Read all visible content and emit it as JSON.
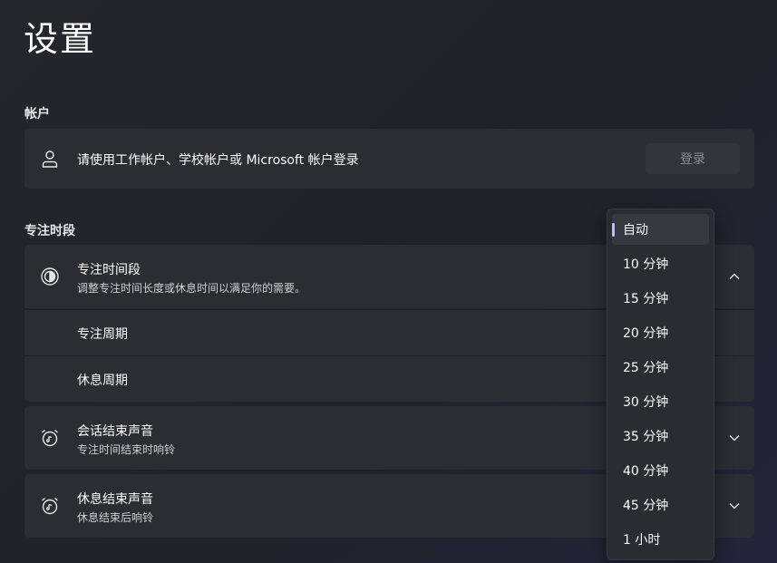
{
  "page": {
    "title": "设置"
  },
  "account": {
    "section_title": "帐户",
    "prompt": "请使用工作帐户、学校帐户或 Microsoft 帐户登录",
    "signin_label": "登录",
    "icon": "person-icon"
  },
  "focus": {
    "section_title": "专注时段",
    "session": {
      "title": "专注时间段",
      "subtitle": "调整专注时间长度或休息时间以满足你的需要。",
      "icon": "focus-timer-icon"
    },
    "focus_period_label": "专注周期",
    "break_period_label": "休息周期",
    "session_end_sound": {
      "title": "会话结束声音",
      "subtitle": "专注时间结束时响铃",
      "icon": "alarm-clock-icon"
    },
    "break_end_sound": {
      "title": "休息结束声音",
      "subtitle": "休息结束后响铃",
      "icon": "alarm-clock-icon"
    }
  },
  "dropdown": {
    "selected": "自动",
    "options": [
      "自动",
      "10 分钟",
      "15 分钟",
      "20 分钟",
      "25 分钟",
      "30 分钟",
      "35 分钟",
      "40 分钟",
      "45 分钟",
      "1 小时"
    ]
  },
  "colors": {
    "accent": "#c7b8ff",
    "card": "#2c2d33"
  }
}
